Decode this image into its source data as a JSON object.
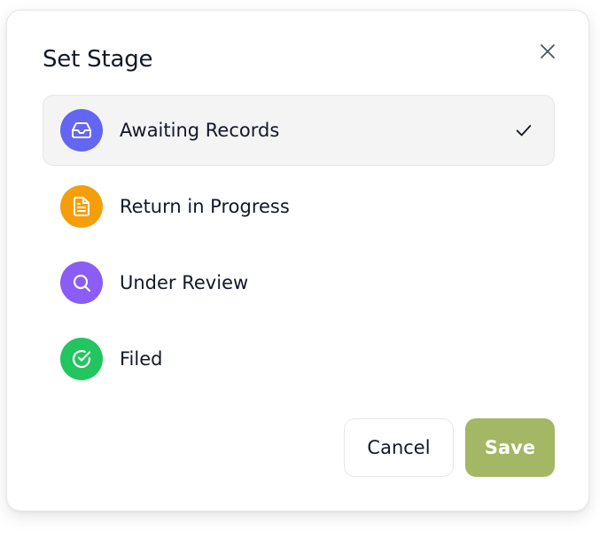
{
  "dialog": {
    "title": "Set Stage",
    "close_icon": "close-icon"
  },
  "stages": [
    {
      "label": "Awaiting Records",
      "icon": "inbox-icon",
      "color": "#6366f1",
      "selected": true
    },
    {
      "label": "Return in Progress",
      "icon": "document-icon",
      "color": "#f59e0b",
      "selected": false
    },
    {
      "label": "Under Review",
      "icon": "search-icon",
      "color": "#8b5cf6",
      "selected": false
    },
    {
      "label": "Filed",
      "icon": "check-circle-icon",
      "color": "#22c55e",
      "selected": false
    }
  ],
  "actions": {
    "cancel_label": "Cancel",
    "save_label": "Save",
    "save_color": "#a3b764"
  }
}
